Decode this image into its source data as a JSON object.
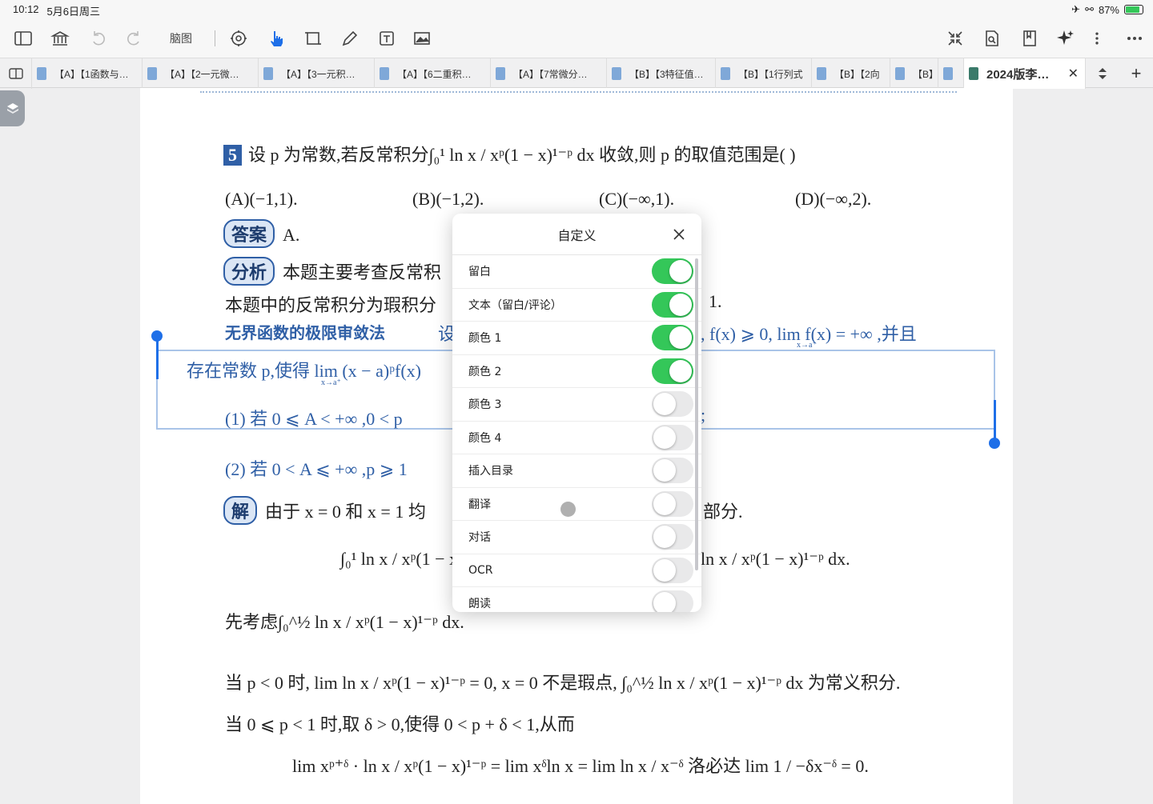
{
  "status": {
    "time": "10:12",
    "date": "5月6日周三",
    "battery": "87%",
    "battery_level": 0.87
  },
  "toolbar": {
    "mindmap_label": "脑图"
  },
  "tabs": [
    {
      "label": "【A】【1函数与…"
    },
    {
      "label": "【A】【2一元微…"
    },
    {
      "label": "【A】【3一元积…"
    },
    {
      "label": "【A】【6二重积…"
    },
    {
      "label": "【A】【7常微分…"
    },
    {
      "label": "【B】【3特征值…"
    },
    {
      "label": "【B】【1行列式"
    },
    {
      "label": "【B】【2向"
    },
    {
      "label": "【B】"
    },
    {
      "label": ""
    },
    {
      "label": "2024版李…"
    }
  ],
  "doc": {
    "q_num": "5",
    "q_text": "设 p 为常数,若反常积分∫₀¹ ln x / xᵖ(1 − x)¹⁻ᵖ dx 收敛,则 p 的取值范围是(        )",
    "opt_a": "(A)(−1,1).",
    "opt_b": "(B)(−1,2).",
    "opt_c": "(C)(−∞,1).",
    "opt_d": "(D)(−∞,2).",
    "answer_tag": "答案",
    "answer": "A.",
    "analysis_tag": "分析",
    "analysis": "本题主要考查反常积",
    "line1_left": "本题中的反常积分为瑕积分",
    "line1_right": "1.",
    "method_left": "无界函数的极限审敛法",
    "method_mid": "设",
    "method_right": ", f(x) ⩾ 0, lim f(x) = +∞ ,并且",
    "method_sub": "x→a⁺",
    "exist_left": "存在常数 p,使得 lim (x − a)ᵖf(x)",
    "exist_sub": "x→a⁺",
    "case1_left": "(1) 若 0 ⩽ A < +∞ ,0 < p",
    "case1_right": ";",
    "case2": "(2) 若 0 < A ⩽ +∞ ,p ⩾ 1",
    "sol_tag": "解",
    "sol_left": "由于 x = 0 和 x = 1 均",
    "sol_right": "部分.",
    "int_left": "∫₀¹ ln x / xᵖ(1 − x)¹⁻",
    "int_right": "ln x / xᵖ(1 − x)¹⁻ᵖ dx.",
    "first": "先考虑∫₀^½ ln x / xᵖ(1 − x)¹⁻ᵖ dx.",
    "when1": "当 p < 0 时, lim ln x / xᵖ(1 − x)¹⁻ᵖ = 0, x = 0 不是瑕点, ∫₀^½ ln x / xᵖ(1 − x)¹⁻ᵖ dx 为常义积分.",
    "when2": "当 0 ⩽ p < 1 时,取 δ > 0,使得 0 < p + δ < 1,从而",
    "limline": "lim xᵖ⁺ᵟ · ln x / xᵖ(1 − x)¹⁻ᵖ = lim xᵟln x = lim ln x / x⁻ᵟ  洛必达  lim 1 / −δx⁻ᵟ = 0."
  },
  "dialog": {
    "title": "自定义",
    "items": [
      {
        "label": "留白",
        "on": true
      },
      {
        "label": "文本（留白/评论）",
        "on": true
      },
      {
        "label": "颜色 1",
        "on": true
      },
      {
        "label": "颜色 2",
        "on": true
      },
      {
        "label": "颜色 3",
        "on": false
      },
      {
        "label": "颜色 4",
        "on": false
      },
      {
        "label": "插入目录",
        "on": false
      },
      {
        "label": "翻译",
        "on": false
      },
      {
        "label": "对话",
        "on": false
      },
      {
        "label": "OCR",
        "on": false
      },
      {
        "label": "朗读",
        "on": false
      }
    ]
  },
  "colors": {
    "accent": "#1e6fe8",
    "toggle_on": "#34c759",
    "doc_blue": "#2f5fa6"
  }
}
